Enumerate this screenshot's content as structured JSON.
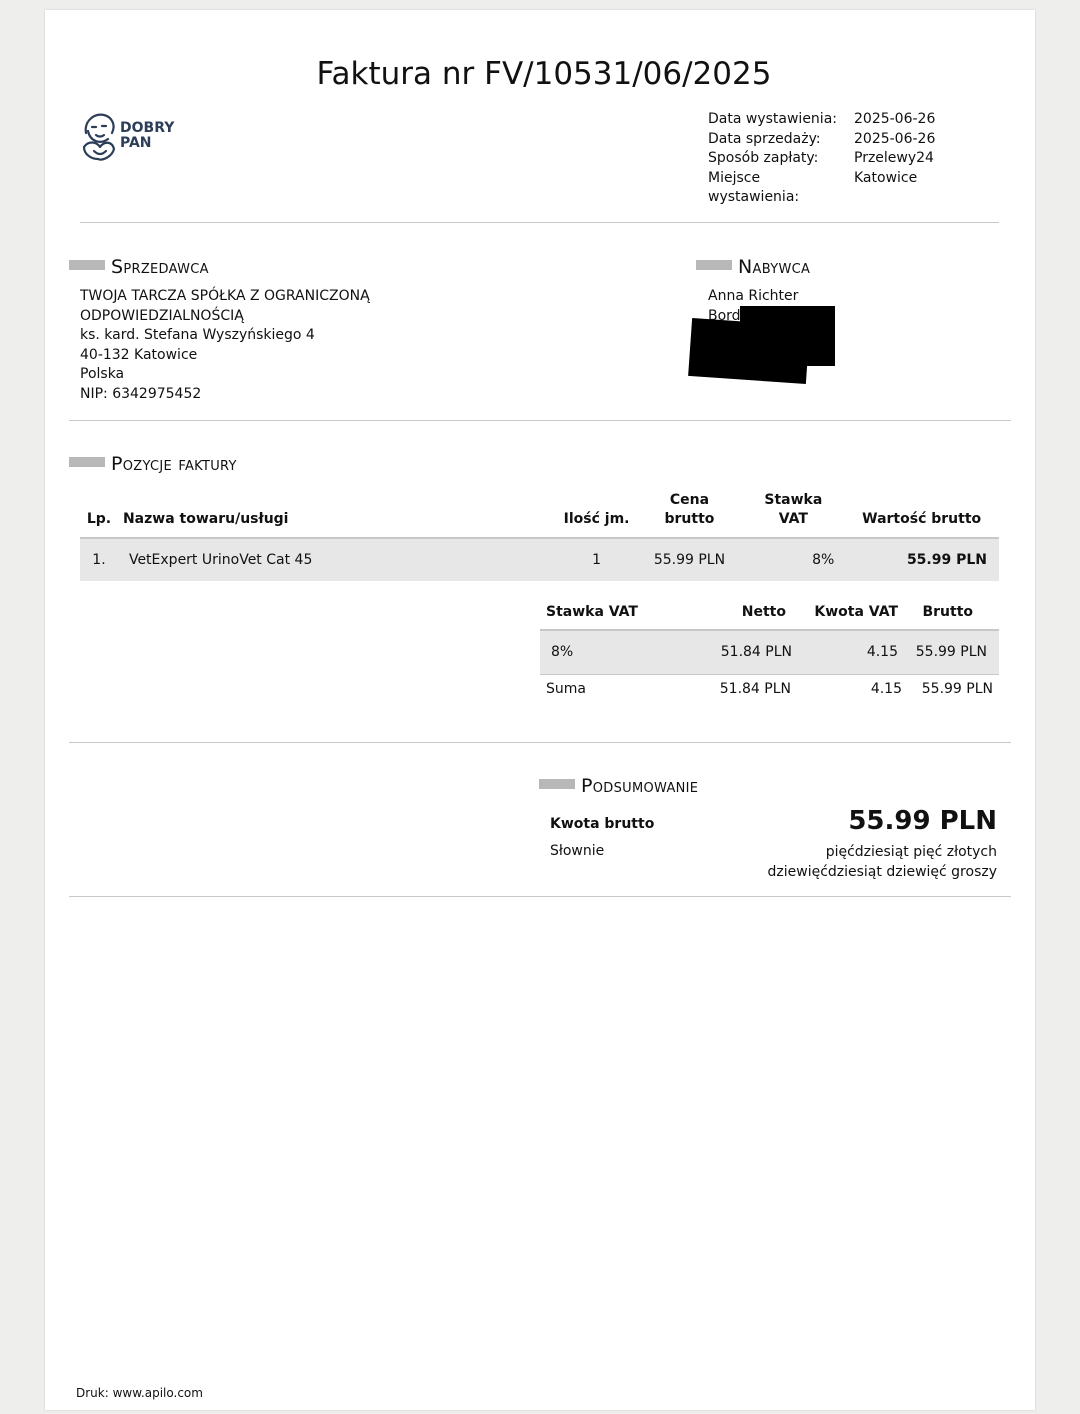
{
  "invoice": {
    "title": "Faktura nr FV/10531/06/2025",
    "logo_line1": "DOBRY",
    "logo_line2": "PAN",
    "meta": [
      {
        "label": "Data wystawienia:",
        "value": "2025-06-26"
      },
      {
        "label": "Data sprzedaży:",
        "value": "2025-06-26"
      },
      {
        "label": "Sposób zapłaty:",
        "value": "Przelewy24"
      },
      {
        "label": "Miejsce wystawienia:",
        "value": "Katowice"
      }
    ]
  },
  "seller": {
    "heading": "Sprzedawca",
    "lines": [
      "TWOJA TARCZA SPÓŁKA Z OGRANICZONĄ",
      "ODPOWIEDZIALNOŚCIĄ",
      "ks. kard. Stefana Wyszyńskiego 4",
      "40-132 Katowice",
      "Polska",
      "NIP: 6342975452"
    ]
  },
  "buyer": {
    "heading": "Nabywca",
    "name": "Anna Richter",
    "partial_line": "Bord"
  },
  "items": {
    "heading": "Pozycje faktury",
    "columns": [
      "Lp.",
      "Nazwa towaru/usługi",
      "Ilość jm.",
      "Cena brutto",
      "Stawka VAT",
      "Wartość brutto"
    ],
    "rows": [
      {
        "lp": "1.",
        "name": "VetExpert UrinoVet Cat 45",
        "qty": "1",
        "price": "55.99 PLN",
        "vat": "8%",
        "total": "55.99 PLN"
      }
    ]
  },
  "vat_table": {
    "columns": [
      "Stawka VAT",
      "Netto",
      "Kwota VAT",
      "Brutto"
    ],
    "rows": [
      {
        "rate": "8%",
        "net": "51.84 PLN",
        "vat": "4.15",
        "gross": "55.99 PLN"
      }
    ],
    "sum": {
      "label": "Suma",
      "net": "51.84 PLN",
      "vat": "4.15",
      "gross": "55.99 PLN"
    }
  },
  "summary": {
    "heading": "Podsumowanie",
    "gross_label": "Kwota brutto",
    "gross_value": "55.99 PLN",
    "words_label": "Słownie",
    "words_line1": "pięćdziesiąt pięć złotych",
    "words_line2": "dziewięćdziesiąt dziewięć groszy"
  },
  "footer": {
    "text": "Druk: www.apilo.com"
  }
}
